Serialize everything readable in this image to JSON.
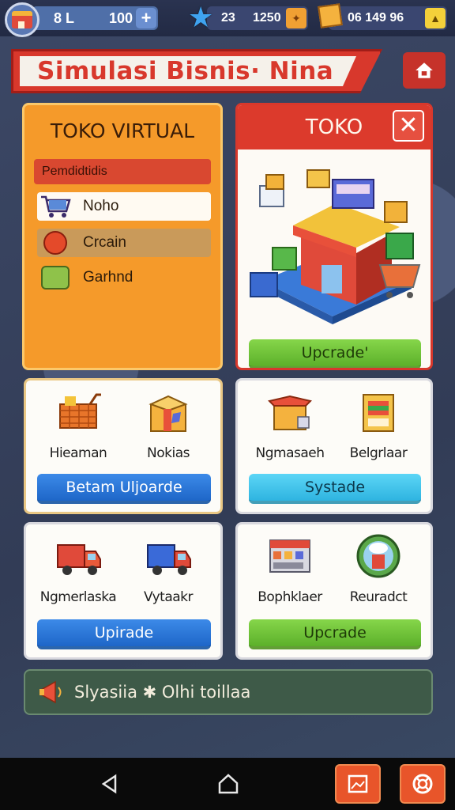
{
  "topbar": {
    "pill1_value_a": "8 L",
    "pill1_value_b": "100",
    "plus_label": "+",
    "pill2_value_a": "23",
    "pill2_value_b": "1250",
    "pill3_value": "06 149 96"
  },
  "banner": {
    "title": "Simulasi Bisnis· Nina"
  },
  "toko_virtual": {
    "title": "TOKO VIRTUAL",
    "subtitle": "Pemdidtidis",
    "items": [
      {
        "label": "Noho"
      },
      {
        "label": "Crcain"
      },
      {
        "label": "Garhnd"
      }
    ]
  },
  "toko": {
    "title": "TOKO",
    "close_label": "✕",
    "upgrade_label": "Upcrade'"
  },
  "grid": [
    {
      "left_label": "Hieaman",
      "right_label": "Nokias",
      "button": "Betam Uljoarde"
    },
    {
      "left_label": "Ngmasaeh",
      "right_label": "Belgrlaar",
      "button": "Systade"
    },
    {
      "left_label": "Ngmerlaska",
      "right_label": "Vytaakr",
      "button": "Upirade"
    },
    {
      "left_label": "Bophklaer",
      "right_label": "Reuradct",
      "button": "Upcrade"
    }
  ],
  "notice": {
    "text": "Slyasiia ✱ Olhi  toillaa"
  },
  "colors": {
    "accent_red": "#d8382c",
    "panel_orange": "#f59a2a",
    "button_green": "#5cb02a",
    "button_blue": "#1e66c8",
    "button_cyan": "#2eb4e0"
  }
}
